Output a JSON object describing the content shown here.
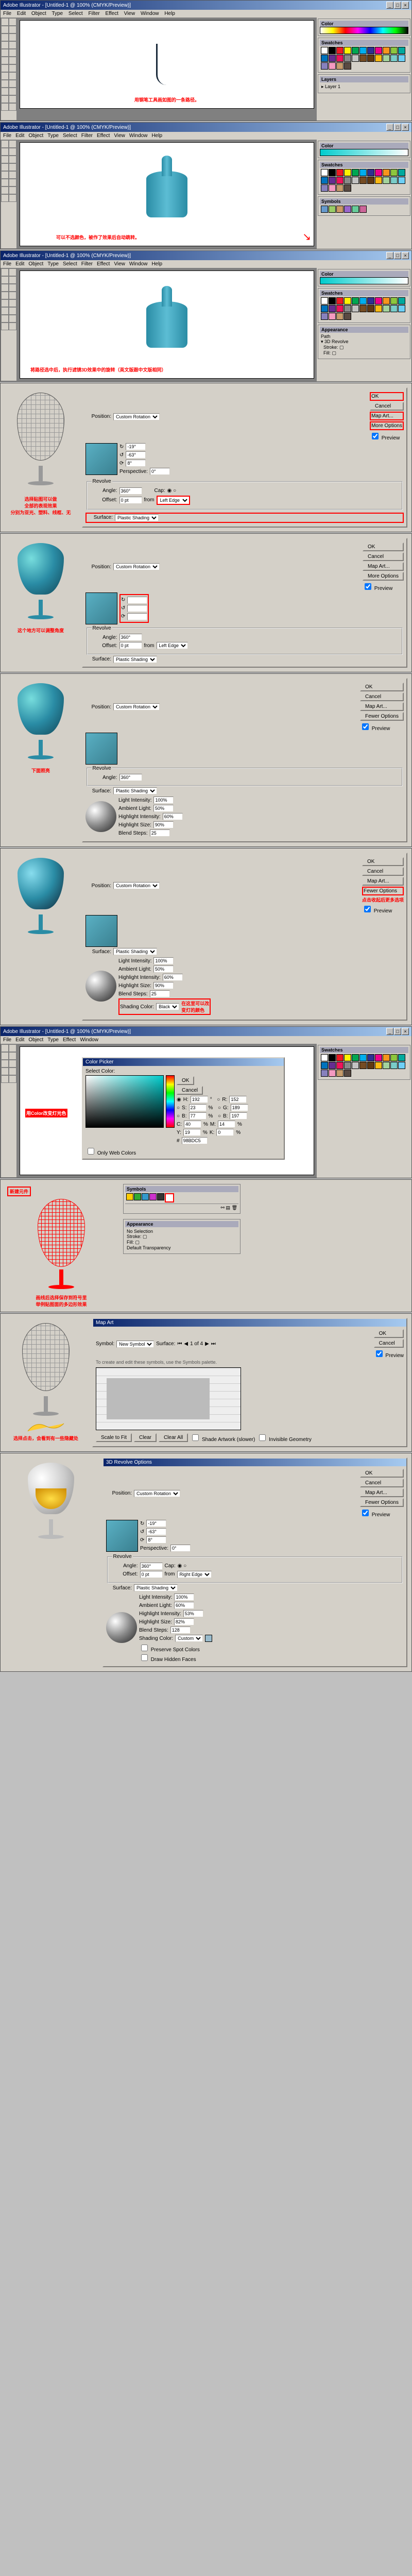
{
  "app_title": "Adobe Illustrator - [Untitled-1 @ 100% (CMYK/Preview)]",
  "menubar": [
    "File",
    "Edit",
    "Object",
    "Type",
    "Select",
    "Filter",
    "Effect",
    "View",
    "Window",
    "Help"
  ],
  "window_buttons": [
    "_",
    "□",
    "×"
  ],
  "tool_option_label": "Adobe Illustrator",
  "swatch_colors": [
    "#ffffff",
    "#000000",
    "#ed1c24",
    "#fff200",
    "#00a651",
    "#00aeef",
    "#2e3192",
    "#ec008c",
    "#f7941d",
    "#8dc63e",
    "#00a99d",
    "#0072bc",
    "#662d91",
    "#ed145b",
    "#898989",
    "#c2c2c2",
    "#754c24",
    "#603913",
    "#fdb913",
    "#a3d39c",
    "#7accc8",
    "#6dcff6",
    "#8781bd",
    "#f49ac1",
    "#c69c6d",
    "#594a42"
  ],
  "step1": {
    "annotation": "用钢笔工具画如图的一条路径。"
  },
  "step2": {
    "annotation": "可以不选颜色，被作了效果后自动跳转。",
    "arrow": "↘"
  },
  "step3": {
    "annotation": "将路径选中后，执行滤镜3D效果中的旋转（英文版跟中文版相同）"
  },
  "revolve_dialog": {
    "title": "3D Revolve Options",
    "position_label": "Position:",
    "position_value": "Custom Rotation",
    "perspective_label": "Perspective:",
    "perspective_value": "0°",
    "revolve_section": "Revolve",
    "angle_label": "Angle:",
    "angle_value": "360°",
    "cap_on": "Cap:",
    "offset_label": "Offset:",
    "offset_value": "0 pt",
    "from_label": "from",
    "from_value": "Left Edge",
    "surface_label": "Surface:",
    "surface_value": "Plastic Shading",
    "ok": "OK",
    "cancel": "Cancel",
    "map_art": "Map Art...",
    "more_options": "More Options",
    "fewer_options": "Fewer Options",
    "preview_label": "Preview"
  },
  "step4": {
    "line1": "选择贴图可以做",
    "line2": "全部的表现效果",
    "line3": "分别为亚光、塑料、线框、无"
  },
  "step5": {
    "annotation": "这个地方可以调整角度"
  },
  "step6": {
    "annotation": "下面照亮"
  },
  "step7": {
    "more_options_note": "点击收起后更多选项",
    "light_intensity": "Light Intensity:",
    "light_intensity_val": "100%",
    "ambient_light": "Ambient Light:",
    "ambient_light_val": "50%",
    "highlight_intensity": "Highlight Intensity:",
    "highlight_intensity_val": "60%",
    "highlight_size": "Highlight Size:",
    "highlight_size_val": "90%",
    "blend_steps": "Blend Steps:",
    "blend_steps_val": "25",
    "shading_color": "Shading Color:",
    "shading_color_val": "Black",
    "note_right": "在这里可以改\n变灯的颜色"
  },
  "colorpicker": {
    "title": "Color Picker",
    "select_color": "Select Color:",
    "ok": "OK",
    "cancel": "Cancel",
    "H": "H:",
    "H_val": "192",
    "H_unit": "°",
    "S": "S:",
    "S_val": "23",
    "S_unit": "%",
    "B": "B:",
    "B_val": "77",
    "B_unit": "%",
    "R": "R:",
    "R_val": "152",
    "G": "G:",
    "G_val": "189",
    "Bl": "B:",
    "Bl_val": "197",
    "C": "C:",
    "C_val": "40",
    "pct": "%",
    "M": "M:",
    "M_val": "14",
    "Y": "Y:",
    "Y_val": "19",
    "K": "K:",
    "K_val": "0",
    "hex": "98BDC5",
    "only_web": "Only Web Colors",
    "annotation": "用Color改变灯光色"
  },
  "symbols_panel": {
    "title": "Symbols",
    "annotation_cn1": "新建元件",
    "annotation_cn2": "画线后选择保存到符号里\n举例贴图面的多边形效果"
  },
  "mapart": {
    "title": "Map Art",
    "symbol_label": "Symbol:",
    "symbol_value": "New Symbol",
    "surface_label": "Surface:",
    "surface_nav": "1 of 4",
    "hint": "To create and edit these symbols, use the Symbols palette.",
    "scale_to_fit": "Scale to Fit",
    "clear": "Clear",
    "clear_all": "Clear All",
    "shade_artwork": "Shade Artwork (slower)",
    "invisible_geo": "Invisible Geometry",
    "ok": "OK",
    "cancel": "Cancel",
    "annotation": "选择点击，会看到有一些隐藏处"
  },
  "final3d": {
    "title": "3D Revolve Options",
    "rot_x": "-19°",
    "rot_y": "-63°",
    "rot_z": "8°",
    "perspective": "0°",
    "angle": "360°",
    "offset": "0 pt",
    "from": "Right Edge",
    "surface": "Plastic Shading",
    "light_intensity": "100%",
    "ambient_light": "60%",
    "highlight_intensity": "53%",
    "highlight_size": "82%",
    "blend_steps": "128",
    "shading_color": "Custom",
    "preserve_spot": "Preserve Spot Colors",
    "draw_hidden": "Draw Hidden Faces"
  }
}
